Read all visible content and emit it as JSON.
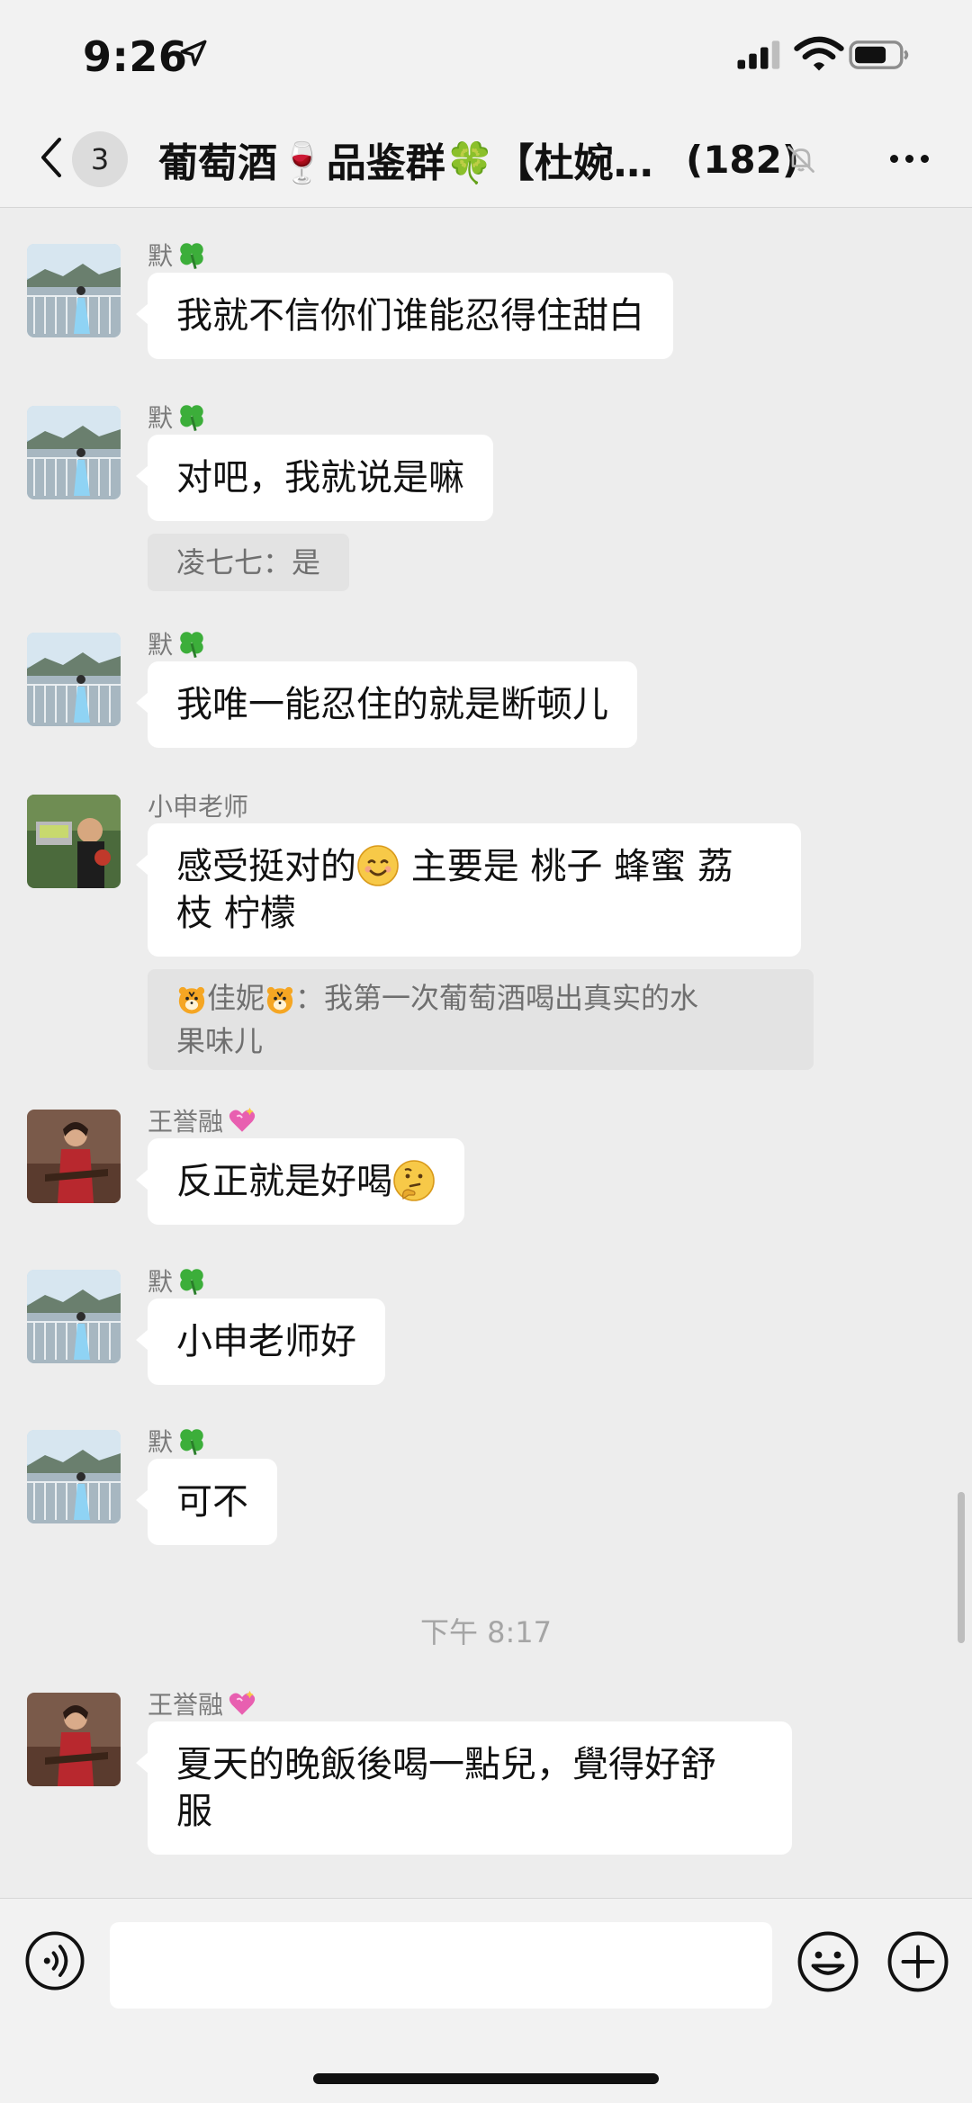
{
  "status_bar": {
    "time": "9:26"
  },
  "nav": {
    "back_count": "3",
    "title": "葡萄酒🍷品鉴群🍀【杜婉…",
    "member_count": "(182)"
  },
  "messages": [
    {
      "sender": "默",
      "sender_badge": "clover",
      "text": "我就不信你们谁能忍得住甜白"
    },
    {
      "sender": "默",
      "sender_badge": "clover",
      "text": "对吧，我就说是嘛",
      "quote": "凌七七：是"
    },
    {
      "sender": "默",
      "sender_badge": "clover",
      "text": "我唯一能忍住的就是断顿儿"
    },
    {
      "sender": "小申老师",
      "sender_badge": "",
      "text_line1_a": "感受挺对的",
      "text_line1_b": " 主要是 桃子 蜂蜜 荔",
      "text_line2": "枝 柠檬",
      "quote_name": "佳妮",
      "quote_text_a": "：我第一次葡萄酒喝出真实的水",
      "quote_text_b": "果味儿"
    },
    {
      "sender": "王誉融",
      "sender_badge": "heart",
      "text": "反正就是好喝"
    },
    {
      "sender": "默",
      "sender_badge": "clover",
      "text": "小申老师好"
    },
    {
      "sender": "默",
      "sender_badge": "clover",
      "text": "可不"
    },
    {
      "sender": "王誉融",
      "sender_badge": "heart",
      "text_line1": "夏天的晚飯後喝一點兒，覺得好舒",
      "text_line2": "服"
    }
  ],
  "time_divider": "下午 8:17",
  "input": {
    "placeholder": ""
  },
  "icons": {
    "back": "chevron-left-icon",
    "mute": "bell-slash-icon",
    "more": "ellipsis-icon",
    "voice": "voice-icon",
    "emoji": "smiley-icon",
    "plus": "plus-icon"
  }
}
